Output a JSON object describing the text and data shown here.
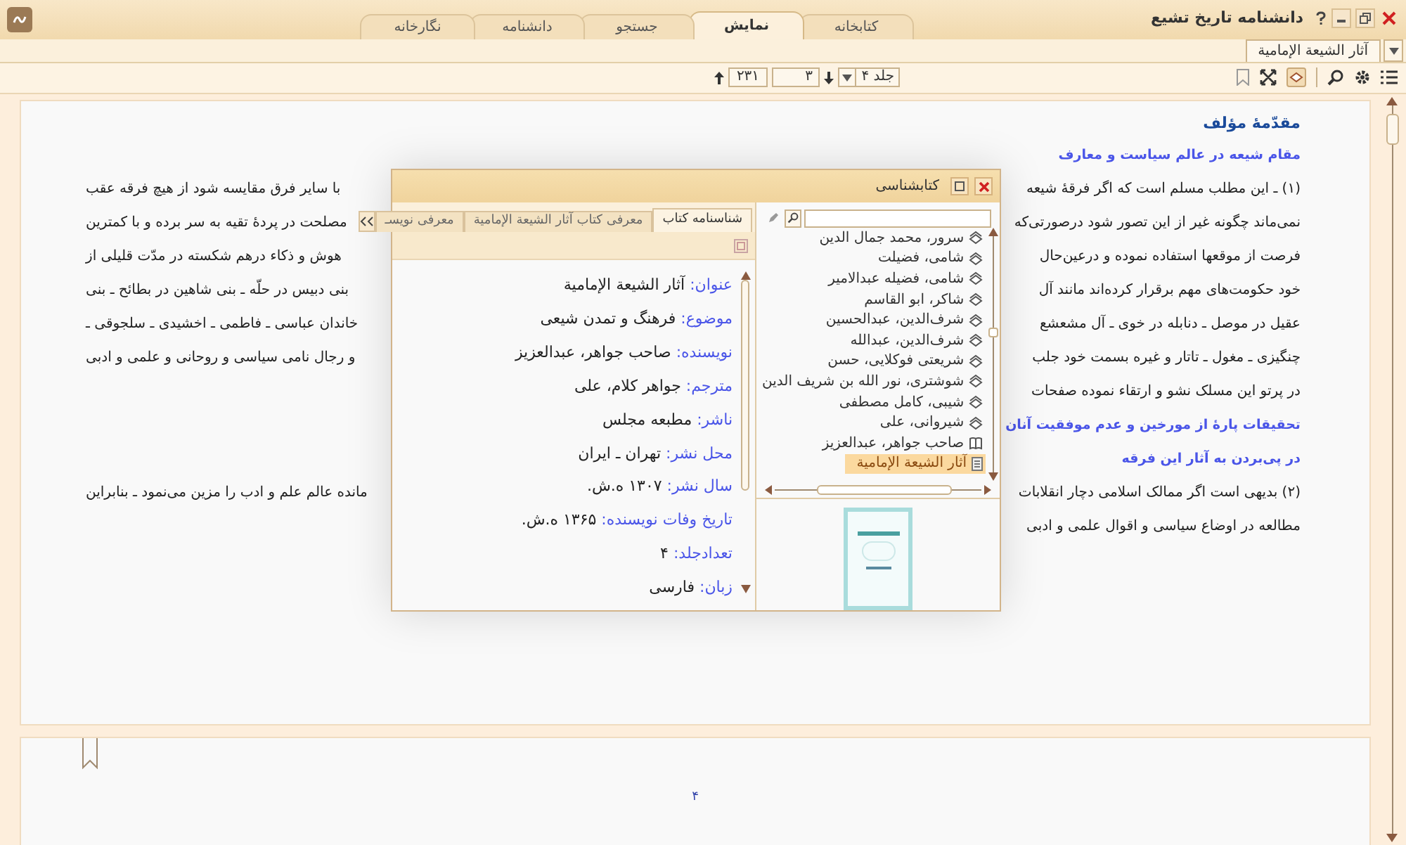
{
  "window": {
    "title": "دانشنامه تاریخ تشیع"
  },
  "tabs": [
    {
      "label": "کتابخانه",
      "selected": false
    },
    {
      "label": "نمایش",
      "selected": true
    },
    {
      "label": "جستجو",
      "selected": false
    },
    {
      "label": "دانشنامه",
      "selected": false
    },
    {
      "label": "نگارخانه",
      "selected": false
    }
  ],
  "document_tabs": [
    {
      "label": "آثار الشیعة الإمامیة",
      "selected": true
    }
  ],
  "navigation": {
    "volume": "جلد ۴",
    "page": "۳",
    "total": "۲۳۱"
  },
  "page": {
    "blocks": [
      {
        "kind": "title",
        "text": "مقدّمهٔ مؤلف"
      },
      {
        "kind": "subheading",
        "text": "مقام شیعه در عالم سیاست و معارف"
      },
      {
        "kind": "line",
        "right": "(۱) ـ این مطلب مسلم است که اگر فرقهٔ شیعه",
        "left": "با سایر فرق مقایسه شود از هیچ فرقه عقب"
      },
      {
        "kind": "line",
        "right": "نمی‌ماند چگونه غیر از این تصور شود درصورتی‌که",
        "left": "مصلحت در پردهٔ تقیه به سر برده و با کمترین"
      },
      {
        "kind": "line",
        "right": "فرصت از موقعها استفاده نموده و درعین‌حال",
        "left": "هوش و ذکاء درهم شکسته در مدّت قلیلی از"
      },
      {
        "kind": "line",
        "right": "خود حکومت‌های مهم برقرار کرده‌اند مانند آل",
        "left": "بنی دبیس در حلّه ـ بنی شاهین در بطائح ـ بنی"
      },
      {
        "kind": "line",
        "right": "عقیل در موصل ـ دنابله در خوی ـ آل مشعشع",
        "left": "خاندان عباسی ـ فاطمی ـ اخشیدی ـ سلجوقی ـ"
      },
      {
        "kind": "line",
        "right": "چنگیزی ـ مغول ـ تاتار و غیره بسمت خود جلب",
        "left": "و رجال نامی سیاسی و روحانی و علمی و ادبی"
      },
      {
        "kind": "line",
        "right": "در پرتو این مسلک نشو و ارتقاء نموده صفحات"
      },
      {
        "kind": "subheading",
        "text": "تحقیقات پارهٔ از مورخین و عدم موفقیت آنان"
      },
      {
        "kind": "subheading",
        "text": "در پی‌بردن به آثار این فرقه"
      },
      {
        "kind": "line",
        "right": "(۲) بدیهی است اگر ممالک اسلامی دچار انقلابات",
        "left": "مانده عالم علم و ادب را مزین می‌نمود ـ بنابراین"
      },
      {
        "kind": "line",
        "right": "مطالعه در اوضاع سیاسی و اقوال علمی و ادبی"
      }
    ]
  },
  "page_2": {
    "page_number": "۴"
  },
  "dialog": {
    "title": "کتابشناسی",
    "tabs": [
      {
        "label": "شناسنامه کتاب",
        "selected": true
      },
      {
        "label": "معرفی کتاب آثار الشیعة الإمامیة",
        "selected": false
      },
      {
        "label": "معرفی نویسـ",
        "selected": false
      }
    ],
    "fields": [
      {
        "label": "عنوان:",
        "value": "آثار الشیعة الإمامیة"
      },
      {
        "label": "موضوع:",
        "value": "فرهنگ و تمدن شیعی"
      },
      {
        "label": "نویسنده:",
        "value": "صاحب جواهر، عبدالعزیز"
      },
      {
        "label": "مترجم:",
        "value": "جواهر کلام، علی"
      },
      {
        "label": "ناشر:",
        "value": "مطبعه مجلس"
      },
      {
        "label": "محل نشر:",
        "value": "تهران ـ ایران"
      },
      {
        "label": "سال نشر:",
        "value": "۱۳۰۷ ه.ش."
      },
      {
        "label": "تاریخ وفات نویسنده:",
        "value": "۱۳۶۵ ه.ش."
      },
      {
        "label": "تعدادجلد:",
        "value": "۴"
      },
      {
        "label": "زبان:",
        "value": "فارسی"
      }
    ],
    "list": [
      {
        "label": "سرور، محمد جمال الدین",
        "kind": "author",
        "selected": false
      },
      {
        "label": "شامی، فضیلت",
        "kind": "author",
        "selected": false
      },
      {
        "label": "شامی، فضیله عبدالامیر",
        "kind": "author",
        "selected": false
      },
      {
        "label": "شاکر، ابو القاسم",
        "kind": "author",
        "selected": false
      },
      {
        "label": "شرف‌الدین، عبدالحسین",
        "kind": "author",
        "selected": false
      },
      {
        "label": "شرف‌الدین، عبدالله",
        "kind": "author",
        "selected": false
      },
      {
        "label": "شریعتی فوکلایی، حسن",
        "kind": "author",
        "selected": false
      },
      {
        "label": "شوشتری، نور الله بن شریف الدین",
        "kind": "author",
        "selected": false
      },
      {
        "label": "شیبی، کامل مصطفی",
        "kind": "author",
        "selected": false
      },
      {
        "label": "شیروانی، علی",
        "kind": "author",
        "selected": false
      },
      {
        "label": "صاحب جواهر، عبدالعزیز",
        "kind": "open",
        "selected": false
      },
      {
        "label": "آثار الشیعة الإمامیة",
        "kind": "book",
        "selected": true
      }
    ]
  }
}
